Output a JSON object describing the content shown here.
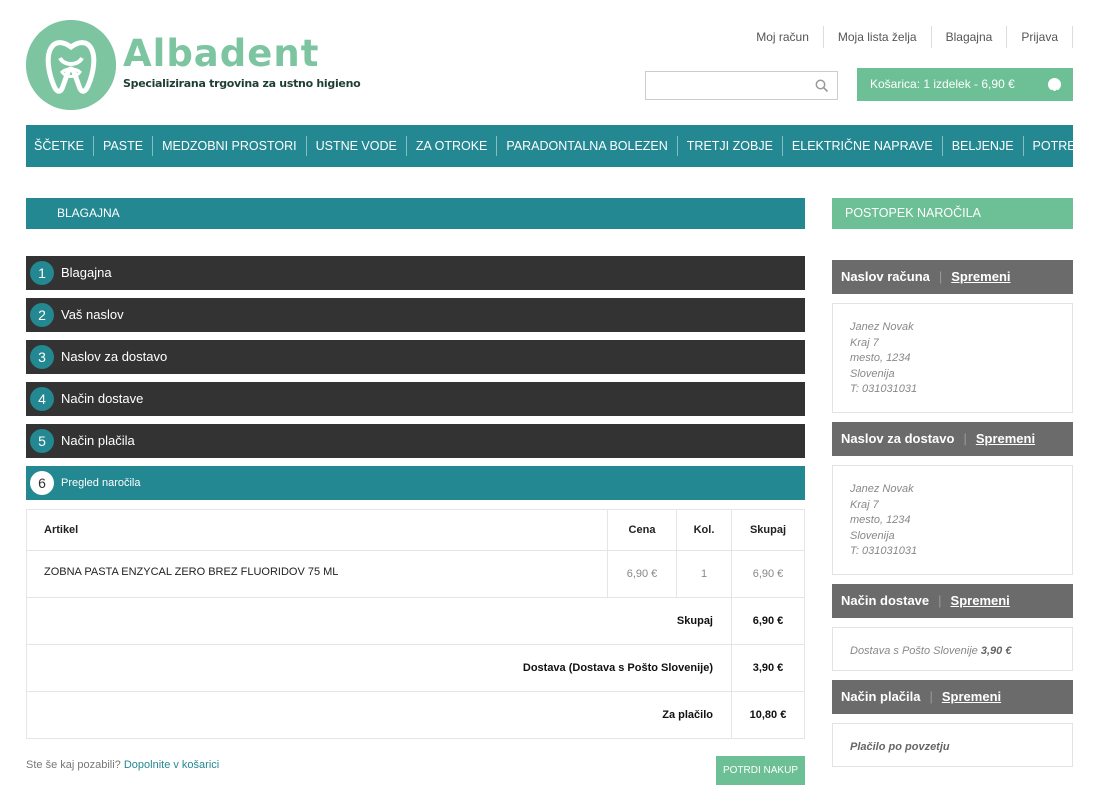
{
  "brand": {
    "name": "Albadent",
    "tagline": "Specializirana trgovina za ustno higieno",
    "color": "#7cc5a0"
  },
  "top_links": [
    "Moj račun",
    "Moja lista želja",
    "Blagajna",
    "Prijava"
  ],
  "search": {
    "placeholder": "",
    "icon": "search-icon"
  },
  "cart": {
    "label": "Košarica: 1 izdelek - 6,90 €",
    "icon": "chevron-down-icon"
  },
  "nav": [
    "ŠČETKE",
    "PASTE",
    "MEDZOBNI PROSTORI",
    "USTNE VODE",
    "ZA OTROKE",
    "PARADONTALNA BOLEZEN",
    "TRETJI ZOBJE",
    "ELEKTRIČNE NAPRAVE",
    "BELJENJE",
    "POTREBUJEM TUDI"
  ],
  "checkout": {
    "title": "BLAGAJNA",
    "steps": [
      {
        "num": "1",
        "label": "Blagajna"
      },
      {
        "num": "2",
        "label": "Vaš naslov"
      },
      {
        "num": "3",
        "label": "Naslov za dostavo"
      },
      {
        "num": "4",
        "label": "Način dostave"
      },
      {
        "num": "5",
        "label": "Način plačila"
      },
      {
        "num": "6",
        "label": "Pregled naročila"
      }
    ],
    "active_step": 6,
    "table": {
      "headers": [
        "Artikel",
        "Cena",
        "Kol.",
        "Skupaj"
      ],
      "rows": [
        {
          "name": "ZOBNA PASTA ENZYCAL ZERO BREZ FLUORIDOV 75 ML",
          "price": "6,90 €",
          "qty": "1",
          "total": "6,90 €"
        }
      ],
      "totals": [
        {
          "label": "Skupaj",
          "value": "6,90 €"
        },
        {
          "label": "Dostava (Dostava s Pošto Slovenije)",
          "value": "3,90 €"
        },
        {
          "label": "Za plačilo",
          "value": "10,80 €"
        }
      ]
    },
    "forgot_text": "Ste še kaj pozabili?",
    "forgot_link": "Dopolnite v košarici",
    "confirm_button": "POTRDI NAKUP"
  },
  "sidebar": {
    "title": "POSTOPEK NAROČILA",
    "change_label": "Spremeni",
    "billing": {
      "heading": "Naslov računa",
      "lines": [
        "Janez Novak",
        "Kraj 7",
        "mesto, 1234",
        "Slovenija",
        "T: 031031031"
      ]
    },
    "shipping": {
      "heading": "Naslov za dostavo",
      "lines": [
        "Janez Novak",
        "Kraj 7",
        "mesto, 1234",
        "Slovenija",
        "T: 031031031"
      ]
    },
    "delivery": {
      "heading": "Način dostave",
      "text": "Dostava s Pošto Slovenije",
      "price": "3,90 €"
    },
    "payment": {
      "heading": "Način plačila",
      "text": "Plačilo po povzetju"
    }
  },
  "colors": {
    "teal": "#238891",
    "green": "#6dbf96",
    "dark": "#333333",
    "gray": "#6b6b6b"
  }
}
